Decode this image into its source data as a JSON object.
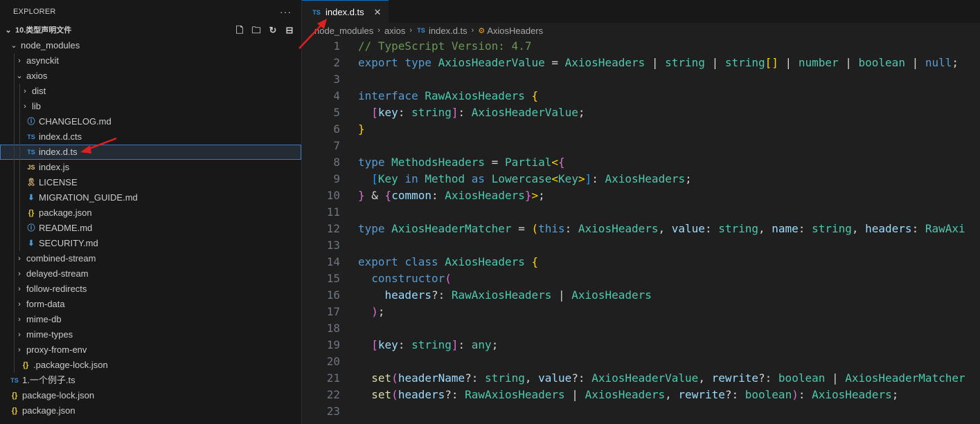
{
  "sidebar": {
    "title": "EXPLORER",
    "more": "···",
    "tree": [
      {
        "label": "10.类型声明文件",
        "depth": 0,
        "kind": "folder-open",
        "bold": true,
        "root": true
      },
      {
        "label": "node_modules",
        "depth": 1,
        "kind": "folder-open"
      },
      {
        "label": "asynckit",
        "depth": 2,
        "kind": "folder-closed"
      },
      {
        "label": "axios",
        "depth": 2,
        "kind": "folder-open"
      },
      {
        "label": "dist",
        "depth": 3,
        "kind": "folder-closed"
      },
      {
        "label": "lib",
        "depth": 3,
        "kind": "folder-closed"
      },
      {
        "label": "CHANGELOG.md",
        "depth": 3,
        "kind": "file",
        "icon": "info-icon"
      },
      {
        "label": "index.d.cts",
        "depth": 3,
        "kind": "file",
        "icon": "ts-icon"
      },
      {
        "label": "index.d.ts",
        "depth": 3,
        "kind": "file",
        "icon": "ts-icon",
        "selected": true
      },
      {
        "label": "index.js",
        "depth": 3,
        "kind": "file",
        "icon": "js-icon"
      },
      {
        "label": "LICENSE",
        "depth": 3,
        "kind": "file",
        "icon": "license-icon"
      },
      {
        "label": "MIGRATION_GUIDE.md",
        "depth": 3,
        "kind": "file",
        "icon": "markdown-icon"
      },
      {
        "label": "package.json",
        "depth": 3,
        "kind": "file",
        "icon": "json-icon"
      },
      {
        "label": "README.md",
        "depth": 3,
        "kind": "file",
        "icon": "info-icon"
      },
      {
        "label": "SECURITY.md",
        "depth": 3,
        "kind": "file",
        "icon": "markdown-icon"
      },
      {
        "label": "combined-stream",
        "depth": 2,
        "kind": "folder-closed"
      },
      {
        "label": "delayed-stream",
        "depth": 2,
        "kind": "folder-closed"
      },
      {
        "label": "follow-redirects",
        "depth": 2,
        "kind": "folder-closed"
      },
      {
        "label": "form-data",
        "depth": 2,
        "kind": "folder-closed"
      },
      {
        "label": "mime-db",
        "depth": 2,
        "kind": "folder-closed"
      },
      {
        "label": "mime-types",
        "depth": 2,
        "kind": "folder-closed"
      },
      {
        "label": "proxy-from-env",
        "depth": 2,
        "kind": "folder-closed"
      },
      {
        "label": ".package-lock.json",
        "depth": 2,
        "kind": "file",
        "icon": "json-icon"
      },
      {
        "label": "1.一个例子.ts",
        "depth": 1,
        "kind": "file",
        "icon": "ts-icon",
        "nochev": true
      },
      {
        "label": "package-lock.json",
        "depth": 1,
        "kind": "file",
        "icon": "json-icon",
        "nochev": true
      },
      {
        "label": "package.json",
        "depth": 1,
        "kind": "file",
        "icon": "json-icon",
        "nochev": true
      }
    ],
    "root_actions": [
      "new-file-icon",
      "new-folder-icon",
      "refresh-icon",
      "collapse-all-icon"
    ]
  },
  "editor": {
    "tab": {
      "label": "index.d.ts",
      "icon": "TS",
      "close": "✕"
    },
    "breadcrumb": [
      "node_modules",
      "axios",
      "index.d.ts",
      "AxiosHeaders"
    ],
    "lines": [
      {
        "n": "1",
        "t": [
          [
            "c",
            "// TypeScript Version: 4.7"
          ]
        ]
      },
      {
        "n": "2",
        "t": [
          [
            "k",
            "export"
          ],
          [
            "p",
            " "
          ],
          [
            "k",
            "type"
          ],
          [
            "p",
            " "
          ],
          [
            "y",
            "AxiosHeaderValue"
          ],
          [
            "p",
            " = "
          ],
          [
            "y",
            "AxiosHeaders"
          ],
          [
            "p",
            " | "
          ],
          [
            "y",
            "string"
          ],
          [
            "p",
            " | "
          ],
          [
            "y",
            "string"
          ],
          [
            "b1",
            "[]"
          ],
          [
            "p",
            " | "
          ],
          [
            "y",
            "number"
          ],
          [
            "p",
            " | "
          ],
          [
            "y",
            "boolean"
          ],
          [
            "p",
            " | "
          ],
          [
            "k",
            "null"
          ],
          [
            "p",
            ";"
          ]
        ]
      },
      {
        "n": "3",
        "t": []
      },
      {
        "n": "4",
        "t": [
          [
            "k",
            "interface"
          ],
          [
            "p",
            " "
          ],
          [
            "y",
            "RawAxiosHeaders"
          ],
          [
            "p",
            " "
          ],
          [
            "b1",
            "{"
          ]
        ]
      },
      {
        "n": "5",
        "t": [
          [
            "p",
            "  "
          ],
          [
            "b2",
            "["
          ],
          [
            "v",
            "key"
          ],
          [
            "p",
            ": "
          ],
          [
            "y",
            "string"
          ],
          [
            "b2",
            "]"
          ],
          [
            "p",
            ": "
          ],
          [
            "y",
            "AxiosHeaderValue"
          ],
          [
            "p",
            ";"
          ]
        ]
      },
      {
        "n": "6",
        "t": [
          [
            "b1",
            "}"
          ]
        ]
      },
      {
        "n": "7",
        "t": []
      },
      {
        "n": "8",
        "t": [
          [
            "k",
            "type"
          ],
          [
            "p",
            " "
          ],
          [
            "y",
            "MethodsHeaders"
          ],
          [
            "p",
            " = "
          ],
          [
            "y",
            "Partial"
          ],
          [
            "b1",
            "<"
          ],
          [
            "b2",
            "{"
          ]
        ]
      },
      {
        "n": "9",
        "t": [
          [
            "p",
            "  "
          ],
          [
            "b3",
            "["
          ],
          [
            "y",
            "Key"
          ],
          [
            "p",
            " "
          ],
          [
            "k",
            "in"
          ],
          [
            "p",
            " "
          ],
          [
            "y",
            "Method"
          ],
          [
            "p",
            " "
          ],
          [
            "k",
            "as"
          ],
          [
            "p",
            " "
          ],
          [
            "y",
            "Lowercase"
          ],
          [
            "b1",
            "<"
          ],
          [
            "y",
            "Key"
          ],
          [
            "b1",
            ">"
          ],
          [
            "b3",
            "]"
          ],
          [
            "p",
            ": "
          ],
          [
            "y",
            "AxiosHeaders"
          ],
          [
            "p",
            ";"
          ]
        ]
      },
      {
        "n": "10",
        "t": [
          [
            "b2",
            "}"
          ],
          [
            "p",
            " & "
          ],
          [
            "b2",
            "{"
          ],
          [
            "v",
            "common"
          ],
          [
            "p",
            ": "
          ],
          [
            "y",
            "AxiosHeaders"
          ],
          [
            "b2",
            "}"
          ],
          [
            "b1",
            ">"
          ],
          [
            "p",
            ";"
          ]
        ]
      },
      {
        "n": "11",
        "t": []
      },
      {
        "n": "12",
        "t": [
          [
            "k",
            "type"
          ],
          [
            "p",
            " "
          ],
          [
            "y",
            "AxiosHeaderMatcher"
          ],
          [
            "p",
            " = "
          ],
          [
            "b1",
            "("
          ],
          [
            "k",
            "this"
          ],
          [
            "p",
            ": "
          ],
          [
            "y",
            "AxiosHeaders"
          ],
          [
            "p",
            ", "
          ],
          [
            "v",
            "value"
          ],
          [
            "p",
            ": "
          ],
          [
            "y",
            "string"
          ],
          [
            "p",
            ", "
          ],
          [
            "v",
            "name"
          ],
          [
            "p",
            ": "
          ],
          [
            "y",
            "string"
          ],
          [
            "p",
            ", "
          ],
          [
            "v",
            "headers"
          ],
          [
            "p",
            ": "
          ],
          [
            "y",
            "RawAxi"
          ]
        ]
      },
      {
        "n": "13",
        "t": []
      },
      {
        "n": "14",
        "t": [
          [
            "k",
            "export"
          ],
          [
            "p",
            " "
          ],
          [
            "k",
            "class"
          ],
          [
            "p",
            " "
          ],
          [
            "y",
            "AxiosHeaders"
          ],
          [
            "p",
            " "
          ],
          [
            "b1",
            "{"
          ]
        ]
      },
      {
        "n": "15",
        "t": [
          [
            "p",
            "  "
          ],
          [
            "k",
            "constructor"
          ],
          [
            "b2",
            "("
          ]
        ]
      },
      {
        "n": "16",
        "t": [
          [
            "p",
            "    "
          ],
          [
            "v",
            "headers"
          ],
          [
            "p",
            "?: "
          ],
          [
            "y",
            "RawAxiosHeaders"
          ],
          [
            "p",
            " | "
          ],
          [
            "y",
            "AxiosHeaders"
          ]
        ]
      },
      {
        "n": "17",
        "t": [
          [
            "p",
            "  "
          ],
          [
            "b2",
            ")"
          ],
          [
            "p",
            ";"
          ]
        ]
      },
      {
        "n": "18",
        "t": []
      },
      {
        "n": "19",
        "t": [
          [
            "p",
            "  "
          ],
          [
            "b2",
            "["
          ],
          [
            "v",
            "key"
          ],
          [
            "p",
            ": "
          ],
          [
            "y",
            "string"
          ],
          [
            "b2",
            "]"
          ],
          [
            "p",
            ": "
          ],
          [
            "y",
            "any"
          ],
          [
            "p",
            ";"
          ]
        ]
      },
      {
        "n": "20",
        "t": []
      },
      {
        "n": "21",
        "t": [
          [
            "p",
            "  "
          ],
          [
            "f",
            "set"
          ],
          [
            "b2",
            "("
          ],
          [
            "v",
            "headerName"
          ],
          [
            "p",
            "?: "
          ],
          [
            "y",
            "string"
          ],
          [
            "p",
            ", "
          ],
          [
            "v",
            "value"
          ],
          [
            "p",
            "?: "
          ],
          [
            "y",
            "AxiosHeaderValue"
          ],
          [
            "p",
            ", "
          ],
          [
            "v",
            "rewrite"
          ],
          [
            "p",
            "?: "
          ],
          [
            "y",
            "boolean"
          ],
          [
            "p",
            " | "
          ],
          [
            "y",
            "AxiosHeaderMatcher"
          ]
        ]
      },
      {
        "n": "22",
        "t": [
          [
            "p",
            "  "
          ],
          [
            "f",
            "set"
          ],
          [
            "b2",
            "("
          ],
          [
            "v",
            "headers"
          ],
          [
            "p",
            "?: "
          ],
          [
            "y",
            "RawAxiosHeaders"
          ],
          [
            "p",
            " | "
          ],
          [
            "y",
            "AxiosHeaders"
          ],
          [
            "p",
            ", "
          ],
          [
            "v",
            "rewrite"
          ],
          [
            "p",
            "?: "
          ],
          [
            "y",
            "boolean"
          ],
          [
            "b2",
            ")"
          ],
          [
            "p",
            ": "
          ],
          [
            "y",
            "AxiosHeaders"
          ],
          [
            "p",
            ";"
          ]
        ]
      },
      {
        "n": "23",
        "t": []
      }
    ]
  },
  "colors": {
    "accent": "#0078d4",
    "arrow": "#e02020"
  }
}
